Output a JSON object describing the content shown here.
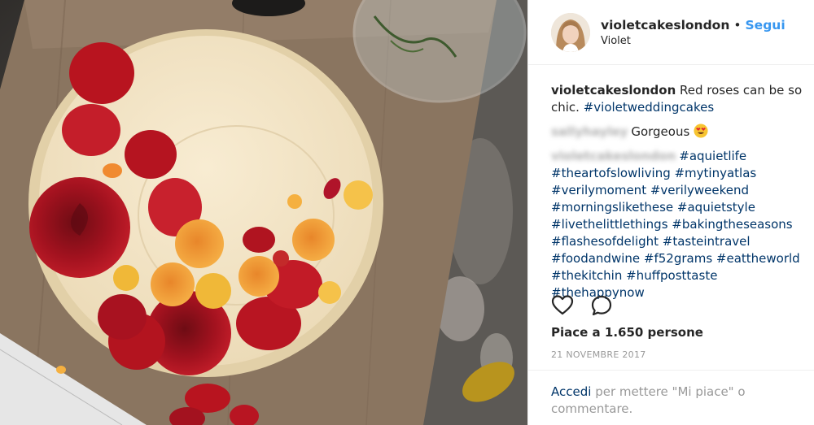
{
  "post": {
    "username": "violetcakeslondon",
    "dot": "•",
    "follow": "Segui",
    "subtitle": "Violet"
  },
  "caption": {
    "username": "violetcakeslondon",
    "text": " Red roses can be so chic. ",
    "hashtag": "#violetweddingcakes"
  },
  "comment1": {
    "username": "sallyhayley",
    "text": "Gorgeous "
  },
  "comment2": {
    "username": "violetcakeslondon",
    "lines": [
      "#aquietlife",
      "#theartofslowliving #mytinyatlas",
      "#verilymoment #verilyweekend",
      "#morningslikethese #aquietstyle",
      "#livethelittlethings #bakingtheseasons",
      "#flashesofdelight #tasteintravel",
      "#foodandwine #f52grams #eattheworld",
      "#thekitchin #huffposttaste #thehappynow"
    ]
  },
  "likes": "Piace a 1.650 persone",
  "date": "21 NOVEMBRE 2017",
  "footer": {
    "login": "Accedi",
    "text": " per mettere \"Mi piace\" o commentare."
  },
  "icons": {
    "heart": "heart-icon",
    "comment": "comment-icon",
    "emoji": "heart-eyes-emoji"
  },
  "colors": {
    "link": "#003569",
    "follow": "#3897f0",
    "muted": "#999999"
  }
}
